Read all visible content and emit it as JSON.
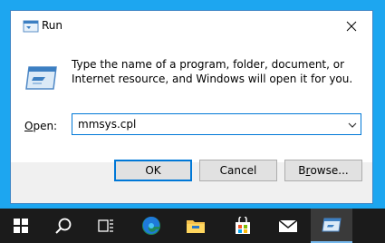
{
  "window": {
    "title": "Run",
    "description": "Type the name of a program, folder, document, or Internet resource, and Windows will open it for you.",
    "open_label_prefix": "O",
    "open_label_rest": "pen:",
    "open_value": "mmsys.cpl"
  },
  "buttons": {
    "ok": "OK",
    "cancel": "Cancel",
    "browse_prefix": "B",
    "browse_u": "r",
    "browse_rest": "owse..."
  },
  "taskbar": {
    "items": [
      "start-icon",
      "search-icon",
      "task-view-icon",
      "edge-icon",
      "file-explorer-icon",
      "store-icon",
      "mail-icon",
      "run-icon"
    ]
  },
  "colors": {
    "desktop": "#1da6f0",
    "accent": "#0078d7",
    "taskbar": "#1b1b1b"
  }
}
